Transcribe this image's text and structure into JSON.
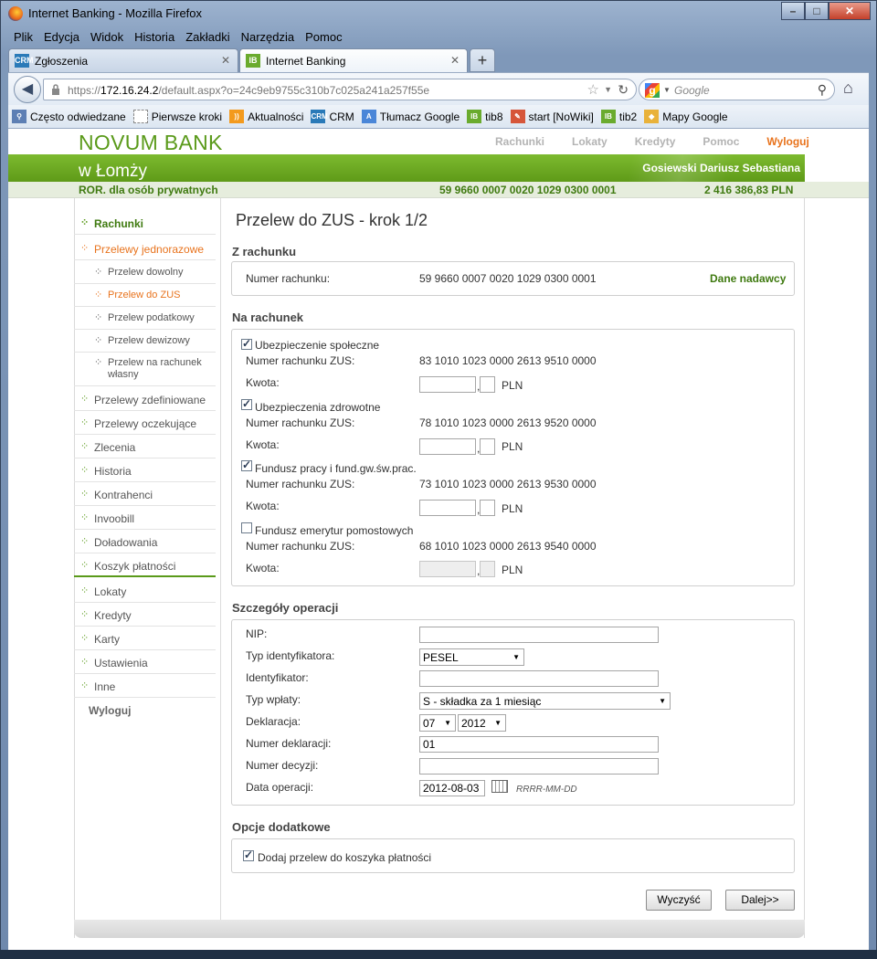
{
  "window": {
    "title": "Internet Banking - Mozilla Firefox"
  },
  "menu": [
    "Plik",
    "Edycja",
    "Widok",
    "Historia",
    "Zakładki",
    "Narzędzia",
    "Pomoc"
  ],
  "tabs": [
    {
      "label": "Zgłoszenia",
      "icon": "CRM"
    },
    {
      "label": "Internet Banking",
      "icon": "IB"
    }
  ],
  "nav": {
    "url_prefix": "https://",
    "url_host": "172.16.24.2",
    "url_rest": "/default.aspx?o=24c9eb9755c310b7c025a241a257f55e",
    "search_placeholder": "Google"
  },
  "bookmarks": [
    {
      "label": "Często odwiedzane",
      "icon": ""
    },
    {
      "label": "Pierwsze kroki",
      "icon": ""
    },
    {
      "label": "Aktualności",
      "icon": ""
    },
    {
      "label": "CRM",
      "icon": "CRM"
    },
    {
      "label": "Tłumacz Google",
      "icon": ""
    },
    {
      "label": "tib8",
      "icon": "IB"
    },
    {
      "label": "start [NoWiki]",
      "icon": ""
    },
    {
      "label": "tib2",
      "icon": "IB"
    },
    {
      "label": "Mapy Google",
      "icon": ""
    }
  ],
  "bank": {
    "name_line1": "NOVUM BANK",
    "name_line2": "w Łomży",
    "top_nav": [
      "Rachunki",
      "Lokaty",
      "Kredyty",
      "Pomoc",
      "Wyloguj"
    ],
    "user": "Gosiewski Dariusz Sebastiana",
    "account_type": "ROR. dla osób prywatnych",
    "account_number": "59 9660 0007 0020 1029 0300 0001",
    "balance": "2 416 386,83 PLN"
  },
  "sidebar": [
    "Rachunki",
    "Przelewy jednorazowe",
    "Przelew dowolny",
    "Przelew do ZUS",
    "Przelew podatkowy",
    "Przelew dewizowy",
    "Przelew na rachunek własny",
    "Przelewy zdefiniowane",
    "Przelewy oczekujące",
    "Zlecenia",
    "Historia",
    "Kontrahenci",
    "Invoobill",
    "Doładowania",
    "Koszyk płatności",
    "Lokaty",
    "Kredyty",
    "Karty",
    "Ustawienia",
    "Inne",
    "Wyloguj"
  ],
  "form": {
    "title": "Przelew do ZUS - krok 1/2",
    "from_header": "Z rachunku",
    "from_label": "Numer rachunku:",
    "from_value": "59 9660 0007 0020 1029 0300 0001",
    "sender_link": "Dane nadawcy",
    "to_header": "Na rachunek",
    "zus_label": "Numer rachunku ZUS:",
    "amount_label": "Kwota:",
    "currency": "PLN",
    "insurances": [
      {
        "name": "Ubezpieczenie społeczne",
        "account": "83 1010 1023 0000 2613 9510 0000",
        "checked": true
      },
      {
        "name": "Ubezpieczenia zdrowotne",
        "account": "78 1010 1023 0000 2613 9520 0000",
        "checked": true
      },
      {
        "name": "Fundusz pracy i fund.gw.św.prac.",
        "account": "73 1010 1023 0000 2613 9530 0000",
        "checked": true
      },
      {
        "name": "Fundusz emerytur pomostowych",
        "account": "68 1010 1023 0000 2613 9540 0000",
        "checked": false
      }
    ],
    "details_header": "Szczegóły operacji",
    "nip_label": "NIP:",
    "id_type_label": "Typ identyfikatora:",
    "id_type_value": "PESEL",
    "id_label": "Identyfikator:",
    "payment_type_label": "Typ wpłaty:",
    "payment_type_value": "S - składka za 1 miesiąc",
    "declaration_label": "Deklaracja:",
    "declaration_month": "07",
    "declaration_year": "2012",
    "declaration_number_label": "Numer deklaracji:",
    "declaration_number_value": "01",
    "decision_number_label": "Numer decyzji:",
    "operation_date_label": "Data operacji:",
    "operation_date_value": "2012-08-03",
    "date_format": "RRRR-MM-DD",
    "options_header": "Opcje dodatkowe",
    "add_to_cart_label": "Dodaj przelew do koszyka płatności",
    "clear_button": "Wyczyść",
    "next_button": "Dalej>>"
  }
}
